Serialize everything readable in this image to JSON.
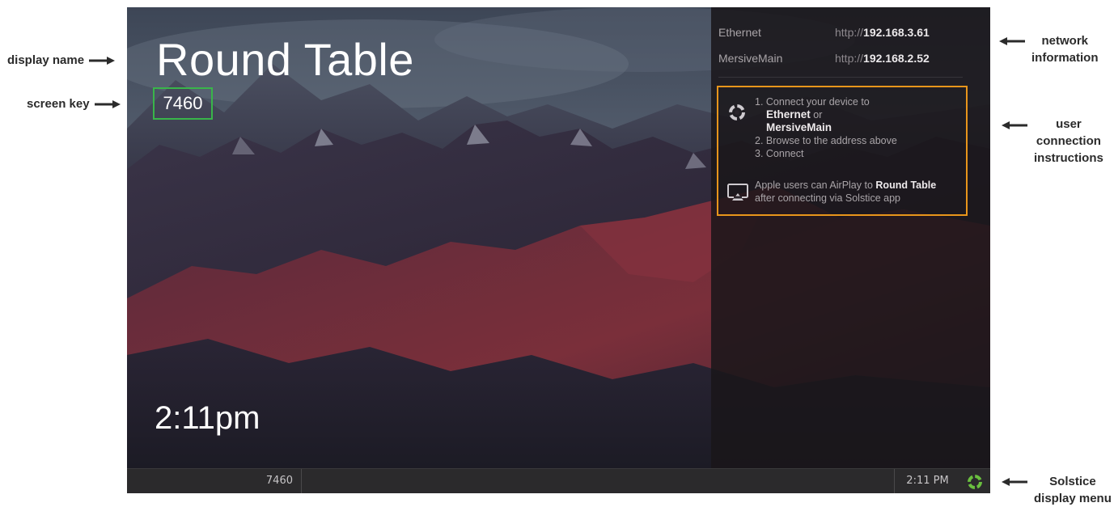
{
  "annotations": {
    "display_name": "display name",
    "screen_key": "screen key",
    "network_info_line1": "network",
    "network_info_line2": "information",
    "user_conn_line1": "user",
    "user_conn_line2": "connection",
    "user_conn_line3": "instructions",
    "solstice_menu_line1": "Solstice",
    "solstice_menu_line2": "display menu"
  },
  "screen": {
    "display_name": "Round Table",
    "screen_key": "7460",
    "clock": "2:11pm"
  },
  "network": [
    {
      "name": "Ethernet",
      "url_prefix": "http://",
      "url_host": "192.168.3.61"
    },
    {
      "name": "MersiveMain",
      "url_prefix": "http://",
      "url_host": "192.168.2.52"
    }
  ],
  "instructions": {
    "step1": "1. Connect your device to",
    "network1": "Ethernet",
    "or": "or",
    "network2": "MersiveMain",
    "step2": "2. Browse to the address above",
    "step3": "3. Connect",
    "airplay_prefix": "Apple users can AirPlay to",
    "airplay_name": "Round Table",
    "airplay_suffix": "after connecting via Solstice app",
    "icons": [
      "solstice-logo-icon",
      "airplay-icon"
    ]
  },
  "bottom_bar": {
    "screen_key": "7460",
    "time": "2:11 PM",
    "menu_icon": "solstice-logo-icon"
  },
  "colors": {
    "screen_key_border": "#39b54a",
    "instructions_border": "#e8951b",
    "solstice_green": "#6abf3f"
  }
}
